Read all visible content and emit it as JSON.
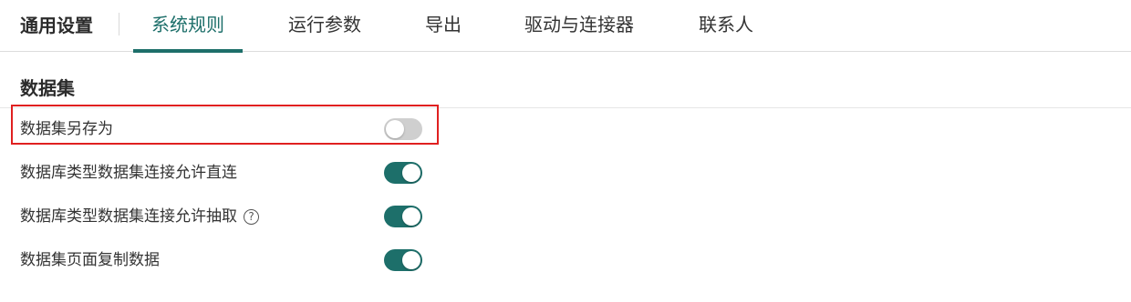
{
  "header": {
    "title": "通用设置",
    "tabs": [
      {
        "label": "系统规则",
        "active": true
      },
      {
        "label": "运行参数",
        "active": false
      },
      {
        "label": "导出",
        "active": false
      },
      {
        "label": "驱动与连接器",
        "active": false
      },
      {
        "label": "联系人",
        "active": false
      }
    ]
  },
  "section": {
    "title": "数据集",
    "settings": [
      {
        "label": "数据集另存为",
        "enabled": false,
        "highlighted": true
      },
      {
        "label": "数据库类型数据集连接允许直连",
        "enabled": true
      },
      {
        "label": "数据库类型数据集连接允许抽取",
        "enabled": true,
        "help_icon": "question-circle-icon",
        "help_glyph": "?"
      },
      {
        "label": "数据集页面复制数据",
        "enabled": true
      }
    ]
  },
  "colors": {
    "accent": "#1d6f6a",
    "toggle_off": "#cfcfcf",
    "highlight": "#e02020"
  }
}
